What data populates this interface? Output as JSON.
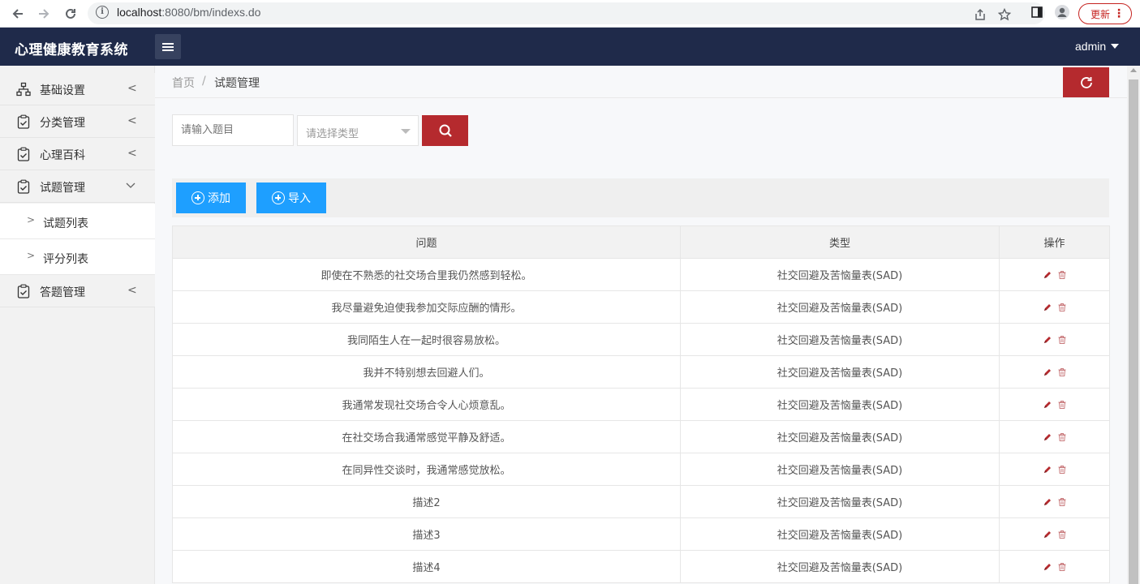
{
  "browser": {
    "url_host": "localhost",
    "url_rest": ":8080/bm/indexs.do",
    "update_label": "更新"
  },
  "header": {
    "brand": "心理健康教育系统",
    "user": "admin"
  },
  "sidebar": {
    "items": [
      {
        "label": "基础设置",
        "icon": "sitemap-icon"
      },
      {
        "label": "分类管理",
        "icon": "clipboard-check-icon"
      },
      {
        "label": "心理百科",
        "icon": "clipboard-check-icon"
      },
      {
        "label": "试题管理",
        "icon": "clipboard-check-icon",
        "expanded": true
      },
      {
        "label": "答题管理",
        "icon": "clipboard-check-icon"
      }
    ],
    "sub_items": [
      {
        "label": "试题列表"
      },
      {
        "label": "评分列表"
      }
    ]
  },
  "breadcrumb": {
    "home": "首页",
    "separator": "/",
    "current": "试题管理"
  },
  "search": {
    "placeholder": "请输入题目",
    "type_placeholder": "请选择类型"
  },
  "toolbar": {
    "add_label": "添加",
    "import_label": "导入"
  },
  "table": {
    "headers": [
      "问题",
      "类型",
      "操作"
    ],
    "rows": [
      {
        "question": "即使在不熟悉的社交场合里我仍然感到轻松。",
        "type": "社交回避及苦恼量表(SAD)"
      },
      {
        "question": "我尽量避免迫使我参加交际应酬的情形。",
        "type": "社交回避及苦恼量表(SAD)"
      },
      {
        "question": "我同陌生人在一起时很容易放松。",
        "type": "社交回避及苦恼量表(SAD)"
      },
      {
        "question": "我并不特别想去回避人们。",
        "type": "社交回避及苦恼量表(SAD)"
      },
      {
        "question": "我通常发现社交场合令人心烦意乱。",
        "type": "社交回避及苦恼量表(SAD)"
      },
      {
        "question": "在社交场合我通常感觉平静及舒适。",
        "type": "社交回避及苦恼量表(SAD)"
      },
      {
        "question": "在同异性交谈时，我通常感觉放松。",
        "type": "社交回避及苦恼量表(SAD)"
      },
      {
        "question": "描述2",
        "type": "社交回避及苦恼量表(SAD)"
      },
      {
        "question": "描述3",
        "type": "社交回避及苦恼量表(SAD)"
      },
      {
        "question": "描述4",
        "type": "社交回避及苦恼量表(SAD)"
      }
    ]
  },
  "colors": {
    "header_bg": "#1f2a4a",
    "primary_blue": "#1e9fff",
    "danger_red": "#b52a2e"
  }
}
